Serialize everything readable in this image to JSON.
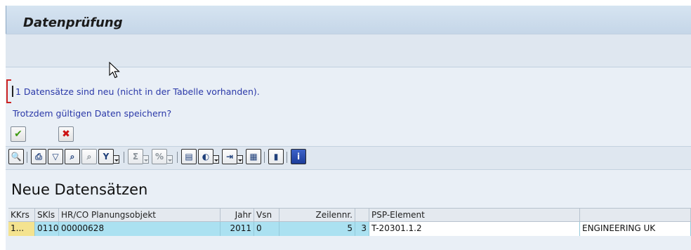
{
  "window": {
    "title": "Datenprüfung"
  },
  "message": {
    "line1": "1 Datensätze sind neu (nicht in der Tabelle vorhanden).",
    "line2": "Trotzdem gültigen Daten speichern?"
  },
  "buttons": {
    "confirm_icon": "✔",
    "cancel_icon": "✖"
  },
  "toolbar": {
    "icons": [
      {
        "name": "details-icon",
        "glyph": "🔍"
      },
      {
        "name": "print-icon",
        "glyph": "⎙"
      },
      {
        "name": "filter-subtotal-icon",
        "glyph": "▽"
      },
      {
        "name": "find-icon",
        "glyph": "⌕"
      },
      {
        "name": "find-next-icon",
        "glyph": "⌕"
      },
      {
        "name": "filter-icon",
        "glyph": "Y"
      },
      {
        "name": "sum-icon",
        "glyph": "Σ"
      },
      {
        "name": "subtotal-icon",
        "glyph": "%"
      },
      {
        "name": "print-preview-icon",
        "glyph": "▤"
      },
      {
        "name": "views-icon",
        "glyph": "◐"
      },
      {
        "name": "export-icon",
        "glyph": "⇥"
      },
      {
        "name": "layout-icon",
        "glyph": "▦"
      },
      {
        "name": "graphic-icon",
        "glyph": "▮"
      },
      {
        "name": "info-icon",
        "glyph": "i"
      }
    ]
  },
  "table": {
    "title": "Neue Datensätzen",
    "columns": [
      "KKrs",
      "SKls",
      "HR/CO Planungsobjekt",
      "Jahr",
      "Vsn",
      "Zeilennr.",
      "",
      "PSP-Element",
      ""
    ],
    "rows": [
      [
        "1...",
        "0110",
        "00000628",
        "2011",
        "0",
        "5",
        "3",
        "T-20301.1.2",
        "ENGINEERING UK"
      ]
    ]
  },
  "colors": {
    "message_text": "#2a38a8",
    "selected_row": "#abe1f1",
    "key_cell": "#f4e38f",
    "confirm": "#3e9a12",
    "cancel": "#cc1111"
  }
}
